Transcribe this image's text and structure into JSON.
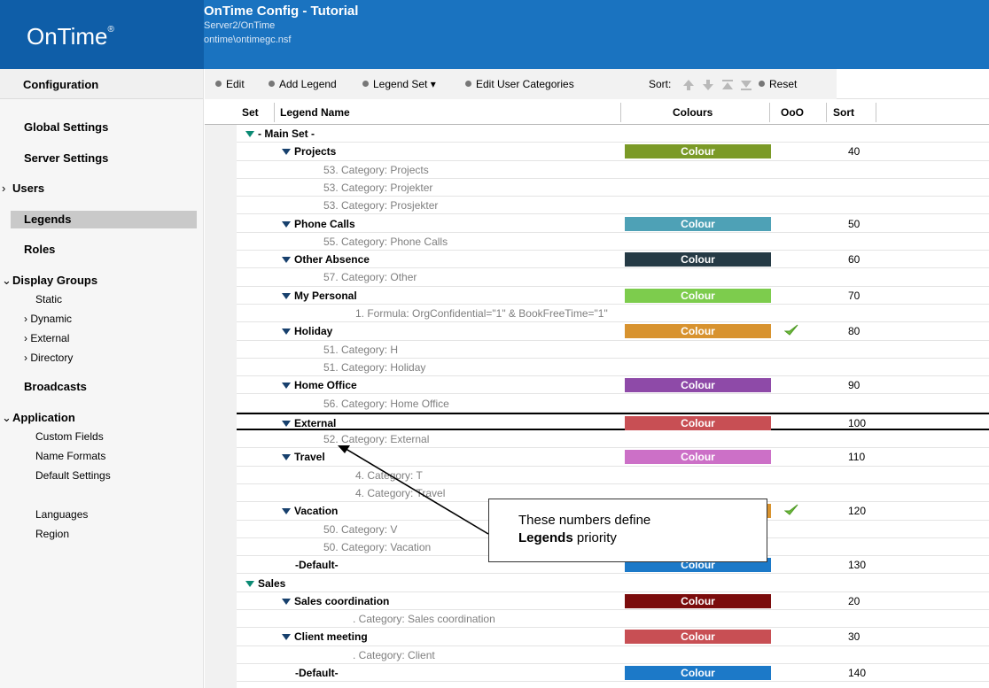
{
  "header": {
    "logo_text": "OnTime",
    "logo_mark": "®",
    "title": "OnTime Config - Tutorial",
    "server": "Server2/OnTime",
    "database": "ontime\\ontimegc.nsf"
  },
  "sidebar": {
    "heading": "Configuration",
    "global_settings": "Global Settings",
    "server_settings": "Server Settings",
    "users": "Users",
    "legends": "Legends",
    "roles": "Roles",
    "display_groups": "Display Groups",
    "static": "Static",
    "dynamic": "Dynamic",
    "external": "External",
    "directory": "Directory",
    "broadcasts": "Broadcasts",
    "application": "Application",
    "custom_fields": "Custom Fields",
    "name_formats": "Name Formats",
    "default_settings": "Default Settings",
    "languages": "Languages",
    "region": "Region"
  },
  "toolbar": {
    "edit": "Edit",
    "add_legend": "Add Legend",
    "legend_set": "Legend Set",
    "edit_user_categories": "Edit User Categories",
    "sort_label": "Sort:",
    "reset": "Reset"
  },
  "columns": {
    "set": "Set",
    "legend_name": "Legend Name",
    "colours": "Colours",
    "ooo": "OoO",
    "sort": "Sort"
  },
  "colour_label": "Colour",
  "rows": [
    {
      "kind": "set",
      "label": "- Main Set -"
    },
    {
      "kind": "legend",
      "label": "Projects",
      "color": "#7b9a27",
      "sort": "40"
    },
    {
      "kind": "cat",
      "label": "53.  Category: Projects"
    },
    {
      "kind": "cat",
      "label": "53.  Category: Projekter"
    },
    {
      "kind": "cat",
      "label": "53.  Category: Prosjekter"
    },
    {
      "kind": "legend",
      "label": "Phone Calls",
      "color": "#4ea1b6",
      "sort": "50"
    },
    {
      "kind": "cat",
      "label": "55.  Category: Phone Calls"
    },
    {
      "kind": "legend",
      "label": "Other Absence",
      "color": "#253a45",
      "sort": "60"
    },
    {
      "kind": "cat",
      "label": "57.  Category: Other"
    },
    {
      "kind": "legend",
      "label": "My Personal",
      "color": "#7dcc4d",
      "sort": "70"
    },
    {
      "kind": "cat",
      "label": "1.  Formula: OrgConfidential=\"1\" & BookFreeTime=\"1\""
    },
    {
      "kind": "legend",
      "label": "Holiday",
      "color": "#d8932f",
      "sort": "80",
      "ooo": true
    },
    {
      "kind": "cat",
      "label": "51.  Category: H"
    },
    {
      "kind": "cat",
      "label": "51.  Category: Holiday"
    },
    {
      "kind": "legend",
      "label": "Home Office",
      "color": "#8e4aa8",
      "sort": "90"
    },
    {
      "kind": "cat",
      "label": "56.  Category: Home Office"
    },
    {
      "kind": "legend",
      "label": "External",
      "color": "#c84f54",
      "sort": "100",
      "selected": true
    },
    {
      "kind": "cat",
      "label": "52.  Category: External"
    },
    {
      "kind": "legend",
      "label": "Travel",
      "color": "#cc70c7",
      "sort": "110"
    },
    {
      "kind": "cat",
      "label": "4.  Category: T"
    },
    {
      "kind": "cat",
      "label": "4.  Category: Travel"
    },
    {
      "kind": "legend",
      "label": "Vacation",
      "color": "#d8932f",
      "sort": "120",
      "ooo": true
    },
    {
      "kind": "cat",
      "label": "50.  Category: V"
    },
    {
      "kind": "cat",
      "label": "50.  Category: Vacation"
    },
    {
      "kind": "default",
      "label": "-Default-",
      "color": "#1c79c8",
      "sort": "130"
    },
    {
      "kind": "set",
      "label": "Sales"
    },
    {
      "kind": "legend",
      "label": "Sales coordination",
      "color": "#7b0c0c",
      "sort": "20"
    },
    {
      "kind": "cat",
      "label": ".  Category: Sales coordination"
    },
    {
      "kind": "legend",
      "label": "Client meeting",
      "color": "#c84f54",
      "sort": "30"
    },
    {
      "kind": "cat",
      "label": ".  Category: Client"
    },
    {
      "kind": "default",
      "label": "-Default-",
      "color": "#1c79c8",
      "sort": "140"
    }
  ],
  "callout": {
    "line1": "These numbers define",
    "bold": "Legends",
    "rest": " priority"
  }
}
